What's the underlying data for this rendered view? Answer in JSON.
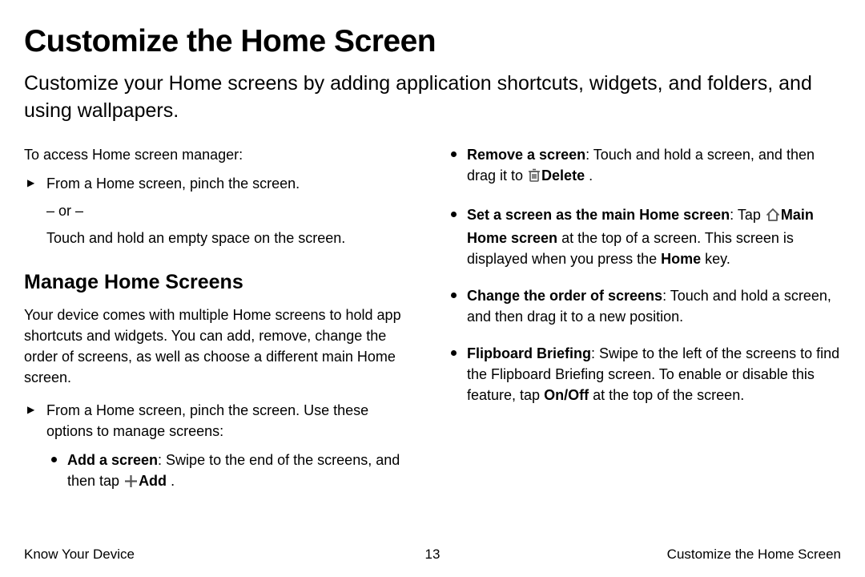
{
  "title": "Customize the Home Screen",
  "intro": "Customize your Home screens by adding application shortcuts, widgets, and folders, and using wallpapers.",
  "left": {
    "access_lead": "To access Home screen manager:",
    "access_step": "From a Home screen, pinch the screen.",
    "or": "– or –",
    "or_sub": "Touch and hold an empty space on the screen.",
    "manage_heading": "Manage Home Screens",
    "manage_para": "Your device comes with multiple Home screens to hold app shortcuts and widgets. You can add, remove, change the order of screens, as well as choose a different main Home screen.",
    "manage_step": "From a Home screen, pinch the screen. Use these options to manage screens:",
    "add_bold": "Add a screen",
    "add_text1": ": Swipe to the end of the screens, and then tap ",
    "add_label": "Add",
    "add_text2": " ."
  },
  "right": {
    "remove_bold": "Remove a screen",
    "remove_text1": ": Touch and hold a screen, and then drag it to ",
    "remove_label": "Delete",
    "remove_text2": " .",
    "setmain_bold": "Set a screen as the main Home screen",
    "setmain_text1": ": Tap ",
    "setmain_label": "Main Home screen",
    "setmain_text2": "  at the top of a screen. This screen is displayed when you press the ",
    "setmain_home": "Home",
    "setmain_text3": " key.",
    "order_bold": "Change the order of screens",
    "order_text": ": Touch and hold a screen, and then drag it to a new position.",
    "flip_bold": "Flipboard Briefing",
    "flip_text1": ": Swipe to the left of the screens to find the Flipboard Briefing screen. To enable or disable this feature, tap ",
    "flip_onoff": "On/Off",
    "flip_text2": " at the top of the screen."
  },
  "footer": {
    "left": "Know Your Device",
    "page": "13",
    "right": "Customize the Home Screen"
  }
}
